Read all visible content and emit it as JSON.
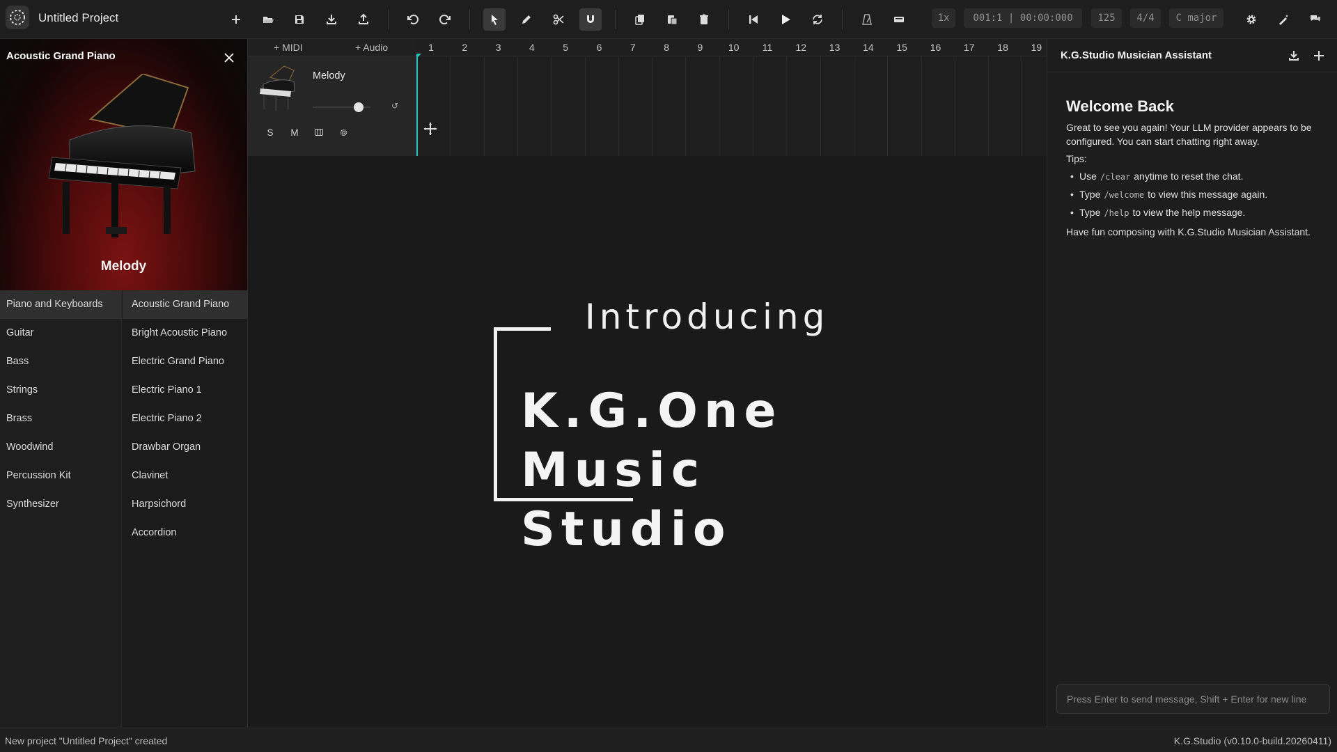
{
  "app": {
    "project_title": "Untitled Project"
  },
  "toolbar": {
    "playback_rate": "1x",
    "position": "001:1 | 00:00:000",
    "tempo": "125",
    "time_signature": "4/4",
    "key": "C major",
    "active_tool": "select",
    "snap_enabled": true
  },
  "instrument_panel": {
    "instrument_name": "Acoustic Grand Piano",
    "track_name": "Melody",
    "categories": [
      {
        "label": "Piano and Keyboards",
        "selected": true
      },
      {
        "label": "Guitar"
      },
      {
        "label": "Bass"
      },
      {
        "label": "Strings"
      },
      {
        "label": "Brass"
      },
      {
        "label": "Woodwind"
      },
      {
        "label": "Percussion Kit"
      },
      {
        "label": "Synthesizer"
      }
    ],
    "presets": [
      {
        "label": "Acoustic Grand Piano",
        "selected": true
      },
      {
        "label": "Bright Acoustic Piano"
      },
      {
        "label": "Electric Grand Piano"
      },
      {
        "label": "Electric Piano 1"
      },
      {
        "label": "Electric Piano 2"
      },
      {
        "label": "Drawbar Organ"
      },
      {
        "label": "Clavinet"
      },
      {
        "label": "Harpsichord"
      },
      {
        "label": "Accordion"
      }
    ]
  },
  "tracks_area": {
    "add_midi_label": "+ MIDI",
    "add_audio_label": "+ Audio",
    "ruler": [
      "1",
      "2",
      "3",
      "4",
      "5",
      "6",
      "7",
      "8",
      "9",
      "10",
      "11",
      "12",
      "13",
      "14",
      "15",
      "16",
      "17",
      "18",
      "19"
    ],
    "tracks": [
      {
        "name": "Melody",
        "volume": 0.8,
        "solo_label": "S",
        "mute_label": "M"
      }
    ]
  },
  "splash": {
    "intro": "Introducing",
    "line1": "K.G.One",
    "line2": "Music",
    "line3": "Studio"
  },
  "assistant": {
    "title": "K.G.Studio Musician Assistant",
    "welcome_title": "Welcome Back",
    "welcome_text": "Great to see you again! Your LLM provider appears to be configured. You can start chatting right away.",
    "tips_label": "Tips:",
    "tips": [
      {
        "pre": "Use",
        "code": "/clear",
        "post": "anytime to reset the chat."
      },
      {
        "pre": "Type",
        "code": "/welcome",
        "post": "to view this message again."
      },
      {
        "pre": "Type",
        "code": "/help",
        "post": "to view the help message."
      }
    ],
    "closing": "Have fun composing with K.G.Studio Musician Assistant.",
    "input_placeholder": "Press Enter to send message, Shift + Enter for new line"
  },
  "status": {
    "message": "New project \"Untitled Project\" created",
    "version": "K.G.Studio (v0.10.0-build.20260411)"
  },
  "colors": {
    "accent": "#27c6c0",
    "background": "#1a1a1a"
  }
}
